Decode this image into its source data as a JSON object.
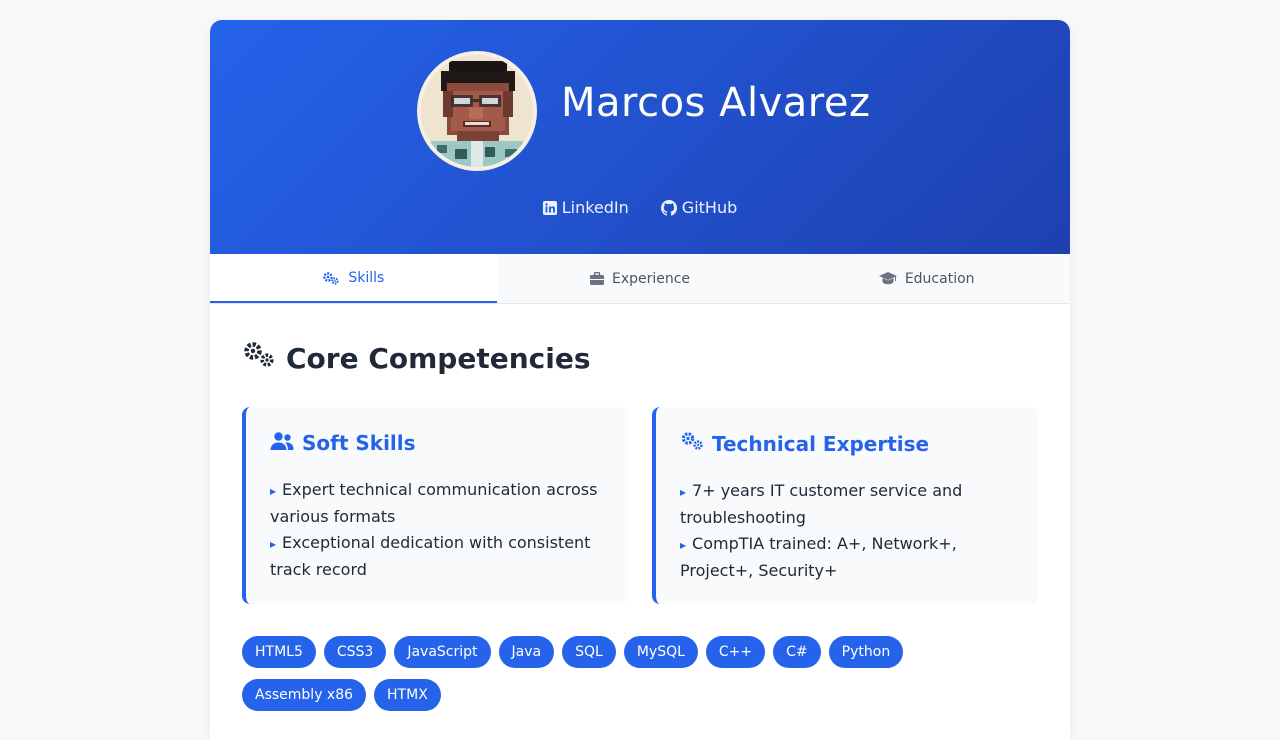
{
  "profile": {
    "name": "Marcos Alvarez",
    "avatar_icon": "profile-photo",
    "links": [
      {
        "label": "LinkedIn",
        "icon": "linkedin-icon"
      },
      {
        "label": "GitHub",
        "icon": "github-icon"
      }
    ]
  },
  "tabs": [
    {
      "label": "Skills",
      "icon": "cogs-icon",
      "active": true
    },
    {
      "label": "Experience",
      "icon": "briefcase-icon",
      "active": false
    },
    {
      "label": "Education",
      "icon": "graduation-cap-icon",
      "active": false
    }
  ],
  "section": {
    "title": "Core Competencies",
    "icon": "cogs-icon",
    "panels": [
      {
        "title": "Soft Skills",
        "icon": "users-icon",
        "items": [
          "Expert technical communication across various formats",
          "Exceptional dedication with consistent track record"
        ]
      },
      {
        "title": "Technical Expertise",
        "icon": "cogs-icon",
        "items": [
          "7+ years IT customer service and troubleshooting",
          "CompTIA trained: A+, Network+, Project+, Security+"
        ]
      }
    ],
    "bullet": "▸"
  },
  "tags": [
    "HTML5",
    "CSS3",
    "JavaScript",
    "Java",
    "SQL",
    "MySQL",
    "C++",
    "C#",
    "Python",
    "Assembly x86",
    "HTMX"
  ],
  "colors": {
    "accent": "#2563eb",
    "header_gradient_start": "#2563eb",
    "header_gradient_end": "#1e40af",
    "panel_bg": "#f8fafc",
    "page_bg": "#f7f8fa"
  }
}
